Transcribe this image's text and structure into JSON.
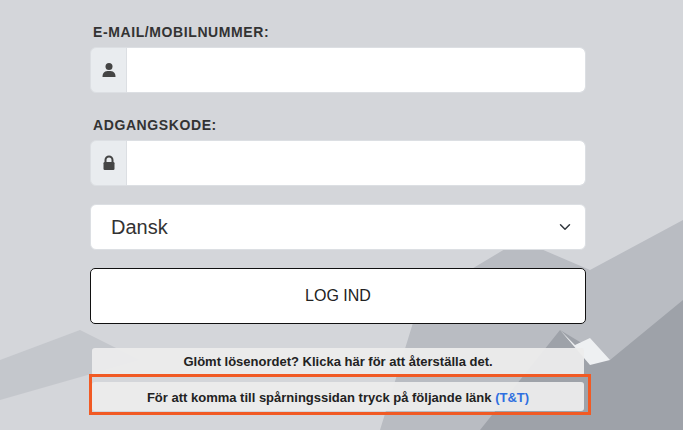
{
  "email": {
    "label": "E-MAIL/MOBILNUMMER:"
  },
  "password": {
    "label": "ADGANGSKODE:"
  },
  "language": {
    "value": "Dansk"
  },
  "login_button": "LOG IND",
  "info_bars": [
    {
      "text": "Glömt lösenordet? Klicka här för att återställa det.",
      "highlighted": false
    },
    {
      "text": "För att komma till spårningssidan tryck på följande länk ",
      "link": "(T&T)",
      "highlighted": true
    }
  ]
}
